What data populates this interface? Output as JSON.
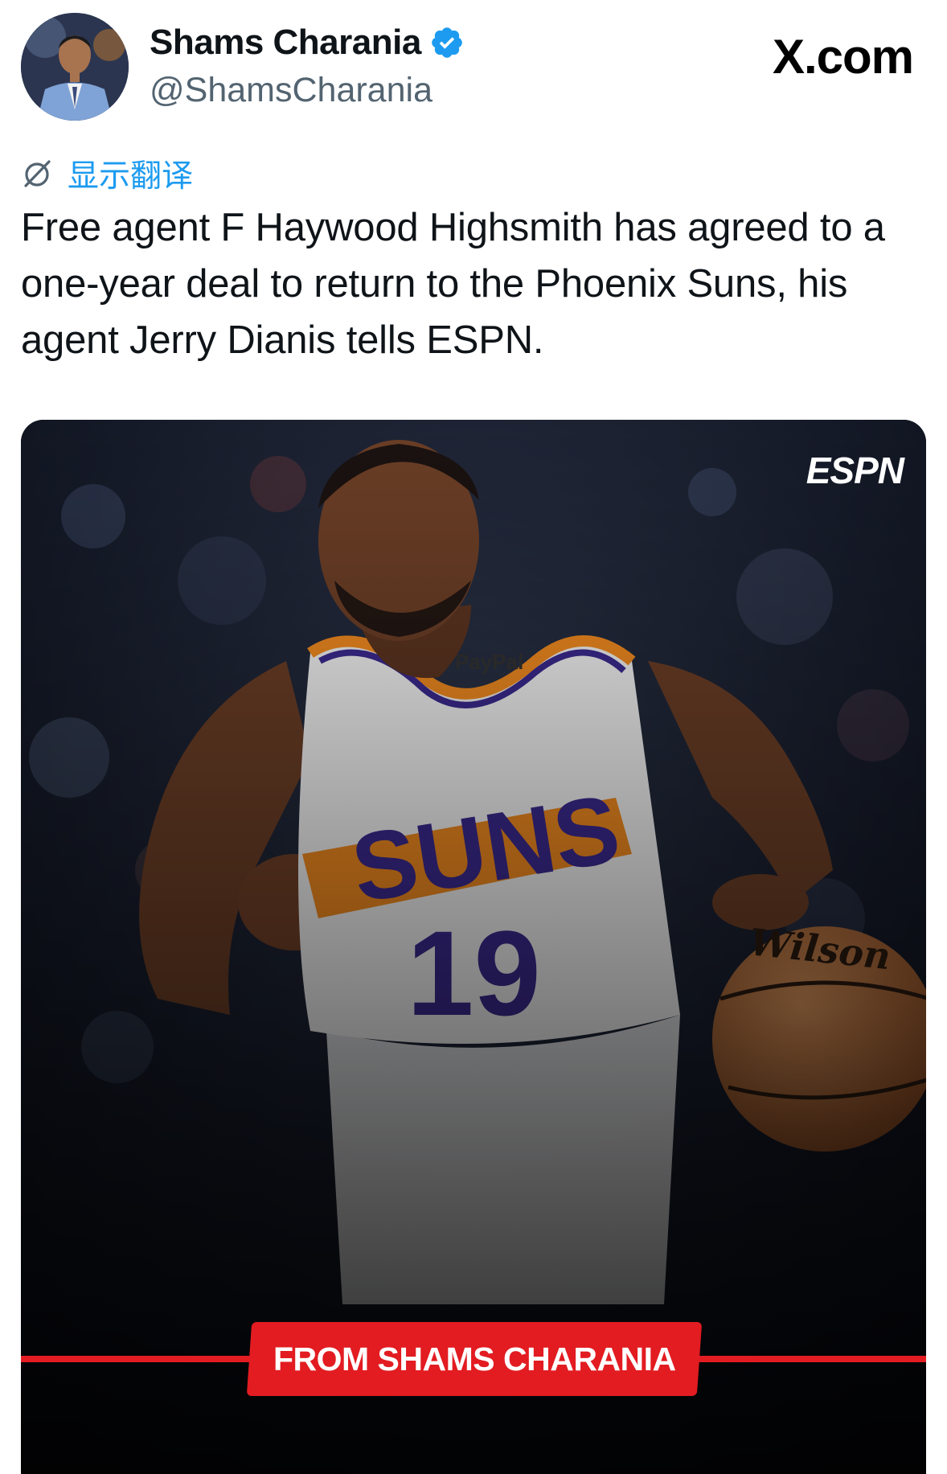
{
  "author": {
    "display_name": "Shams Charania",
    "handle": "@ShamsCharania",
    "verified": true
  },
  "brand": "X.com",
  "translate": {
    "label": "显示翻译",
    "icon": "translate-icon"
  },
  "tweet": {
    "text": "Free agent F Haywood Highsmith has agreed to a one-year deal to return to the Phoenix Suns, his agent Jerry Dianis tells ESPN."
  },
  "media": {
    "logo_text": "ESPN",
    "banner_text": "FROM SHAMS CHARANIA",
    "jersey": {
      "team_word": "SUNS",
      "number": "19",
      "sponsor": "PayPal"
    },
    "ball_brand": "Wilson",
    "colors": {
      "banner": "#e21c21",
      "jersey_orange": "#f28b20",
      "jersey_purple": "#3b2a8f",
      "background": "#101522"
    }
  },
  "colors": {
    "link_blue": "#1d9bf0",
    "handle_gray": "#536471",
    "text": "#0f1419"
  }
}
